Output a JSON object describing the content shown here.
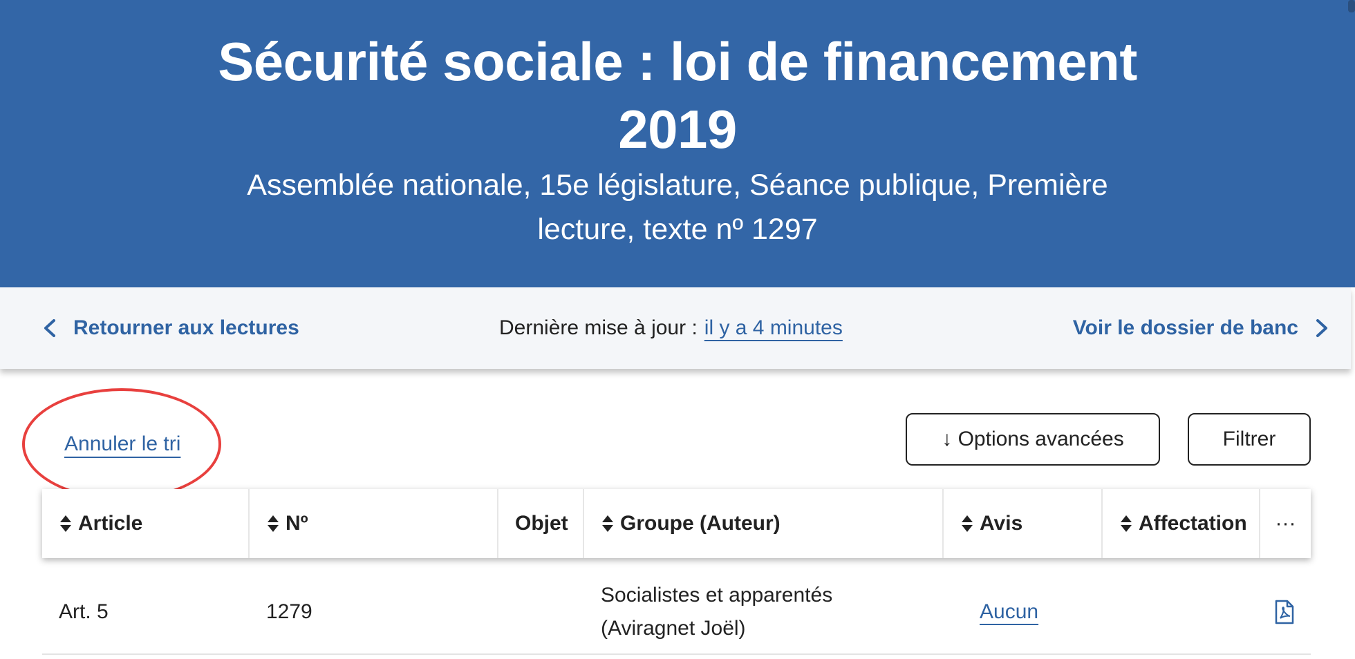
{
  "header": {
    "title": "Sécurité sociale : loi de financement 2019",
    "subtitle": "Assemblée nationale, 15e législature, Séance publique, Première lecture, texte nº 1297"
  },
  "navbar": {
    "back_label": "Retourner aux lectures",
    "update_prefix": "Dernière mise à jour :",
    "update_link": "il y a 4 minutes",
    "dossier_label": "Voir le dossier de banc"
  },
  "toolbar": {
    "annuler_label": "Annuler le tri",
    "options_label": "↓ Options avancées",
    "filtrer_label": "Filtrer"
  },
  "table": {
    "columns": [
      "Article",
      "Nº",
      "Objet",
      "Groupe (Auteur)",
      "Avis",
      "Affectation",
      "···"
    ],
    "rows": [
      {
        "article": "Art. 5",
        "numero": "1279",
        "objet": "",
        "groupe_line1": "Socialistes et apparentés",
        "groupe_line2": "(Aviragnet Joël)",
        "avis": "Aucun",
        "affectation": "",
        "action_icon": "pdf-file-icon"
      }
    ]
  },
  "colors": {
    "brand": "#3366a7",
    "link": "#2f63a3",
    "highlight_circle": "#e8403e"
  }
}
